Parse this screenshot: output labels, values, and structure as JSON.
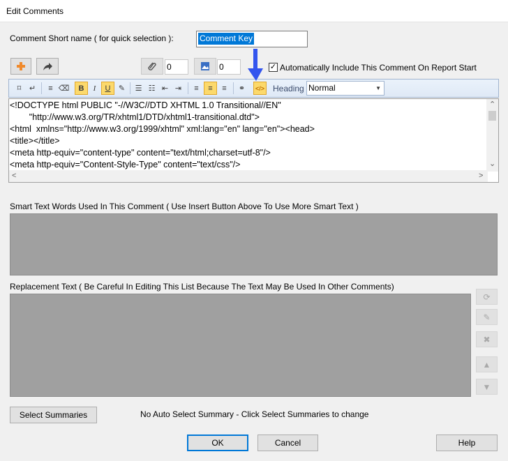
{
  "window": {
    "title": "Edit Comments"
  },
  "short_name": {
    "label": "Comment Short name ( for quick selection ):",
    "value": "Comment Key"
  },
  "action_row": {
    "attachments_count": "0",
    "images_count": "0",
    "auto_include_checked": true,
    "auto_include_label": "Automatically Include This Comment On Report Start"
  },
  "toolbar": {
    "heading_label": "Heading",
    "heading_value": "Normal",
    "active_color": "#fcd96b"
  },
  "editor": {
    "lines": [
      "<!DOCTYPE html PUBLIC \"-//W3C//DTD XHTML 1.0 Transitional//EN\"",
      "        \"http://www.w3.org/TR/xhtml1/DTD/xhtml1-transitional.dtd\">",
      "<html  xmlns=\"http://www.w3.org/1999/xhtml\" xml:lang=\"en\" lang=\"en\"><head>",
      "<title></title>",
      "<meta http-equiv=\"content-type\" content=\"text/html;charset=utf-8\"/>",
      "<meta http-equiv=\"Content-Style-Type\" content=\"text/css\"/>"
    ]
  },
  "smart_text": {
    "label": "Smart Text Words Used In This Comment ( Use Insert Button Above To Use More Smart Text )"
  },
  "replacement_text": {
    "label": "Replacement Text ( Be Careful In Editing This List Because The Text May Be Used In Other Comments)"
  },
  "summaries": {
    "button_label": "Select Summaries",
    "status": "No Auto Select Summary - Click Select Summaries to change"
  },
  "footer": {
    "ok_label": "OK",
    "cancel_label": "Cancel",
    "help_label": "Help"
  },
  "colors": {
    "accent": "#0078d7",
    "pointer_arrow": "#3355ee",
    "panel_gray": "#a0a0a0"
  }
}
